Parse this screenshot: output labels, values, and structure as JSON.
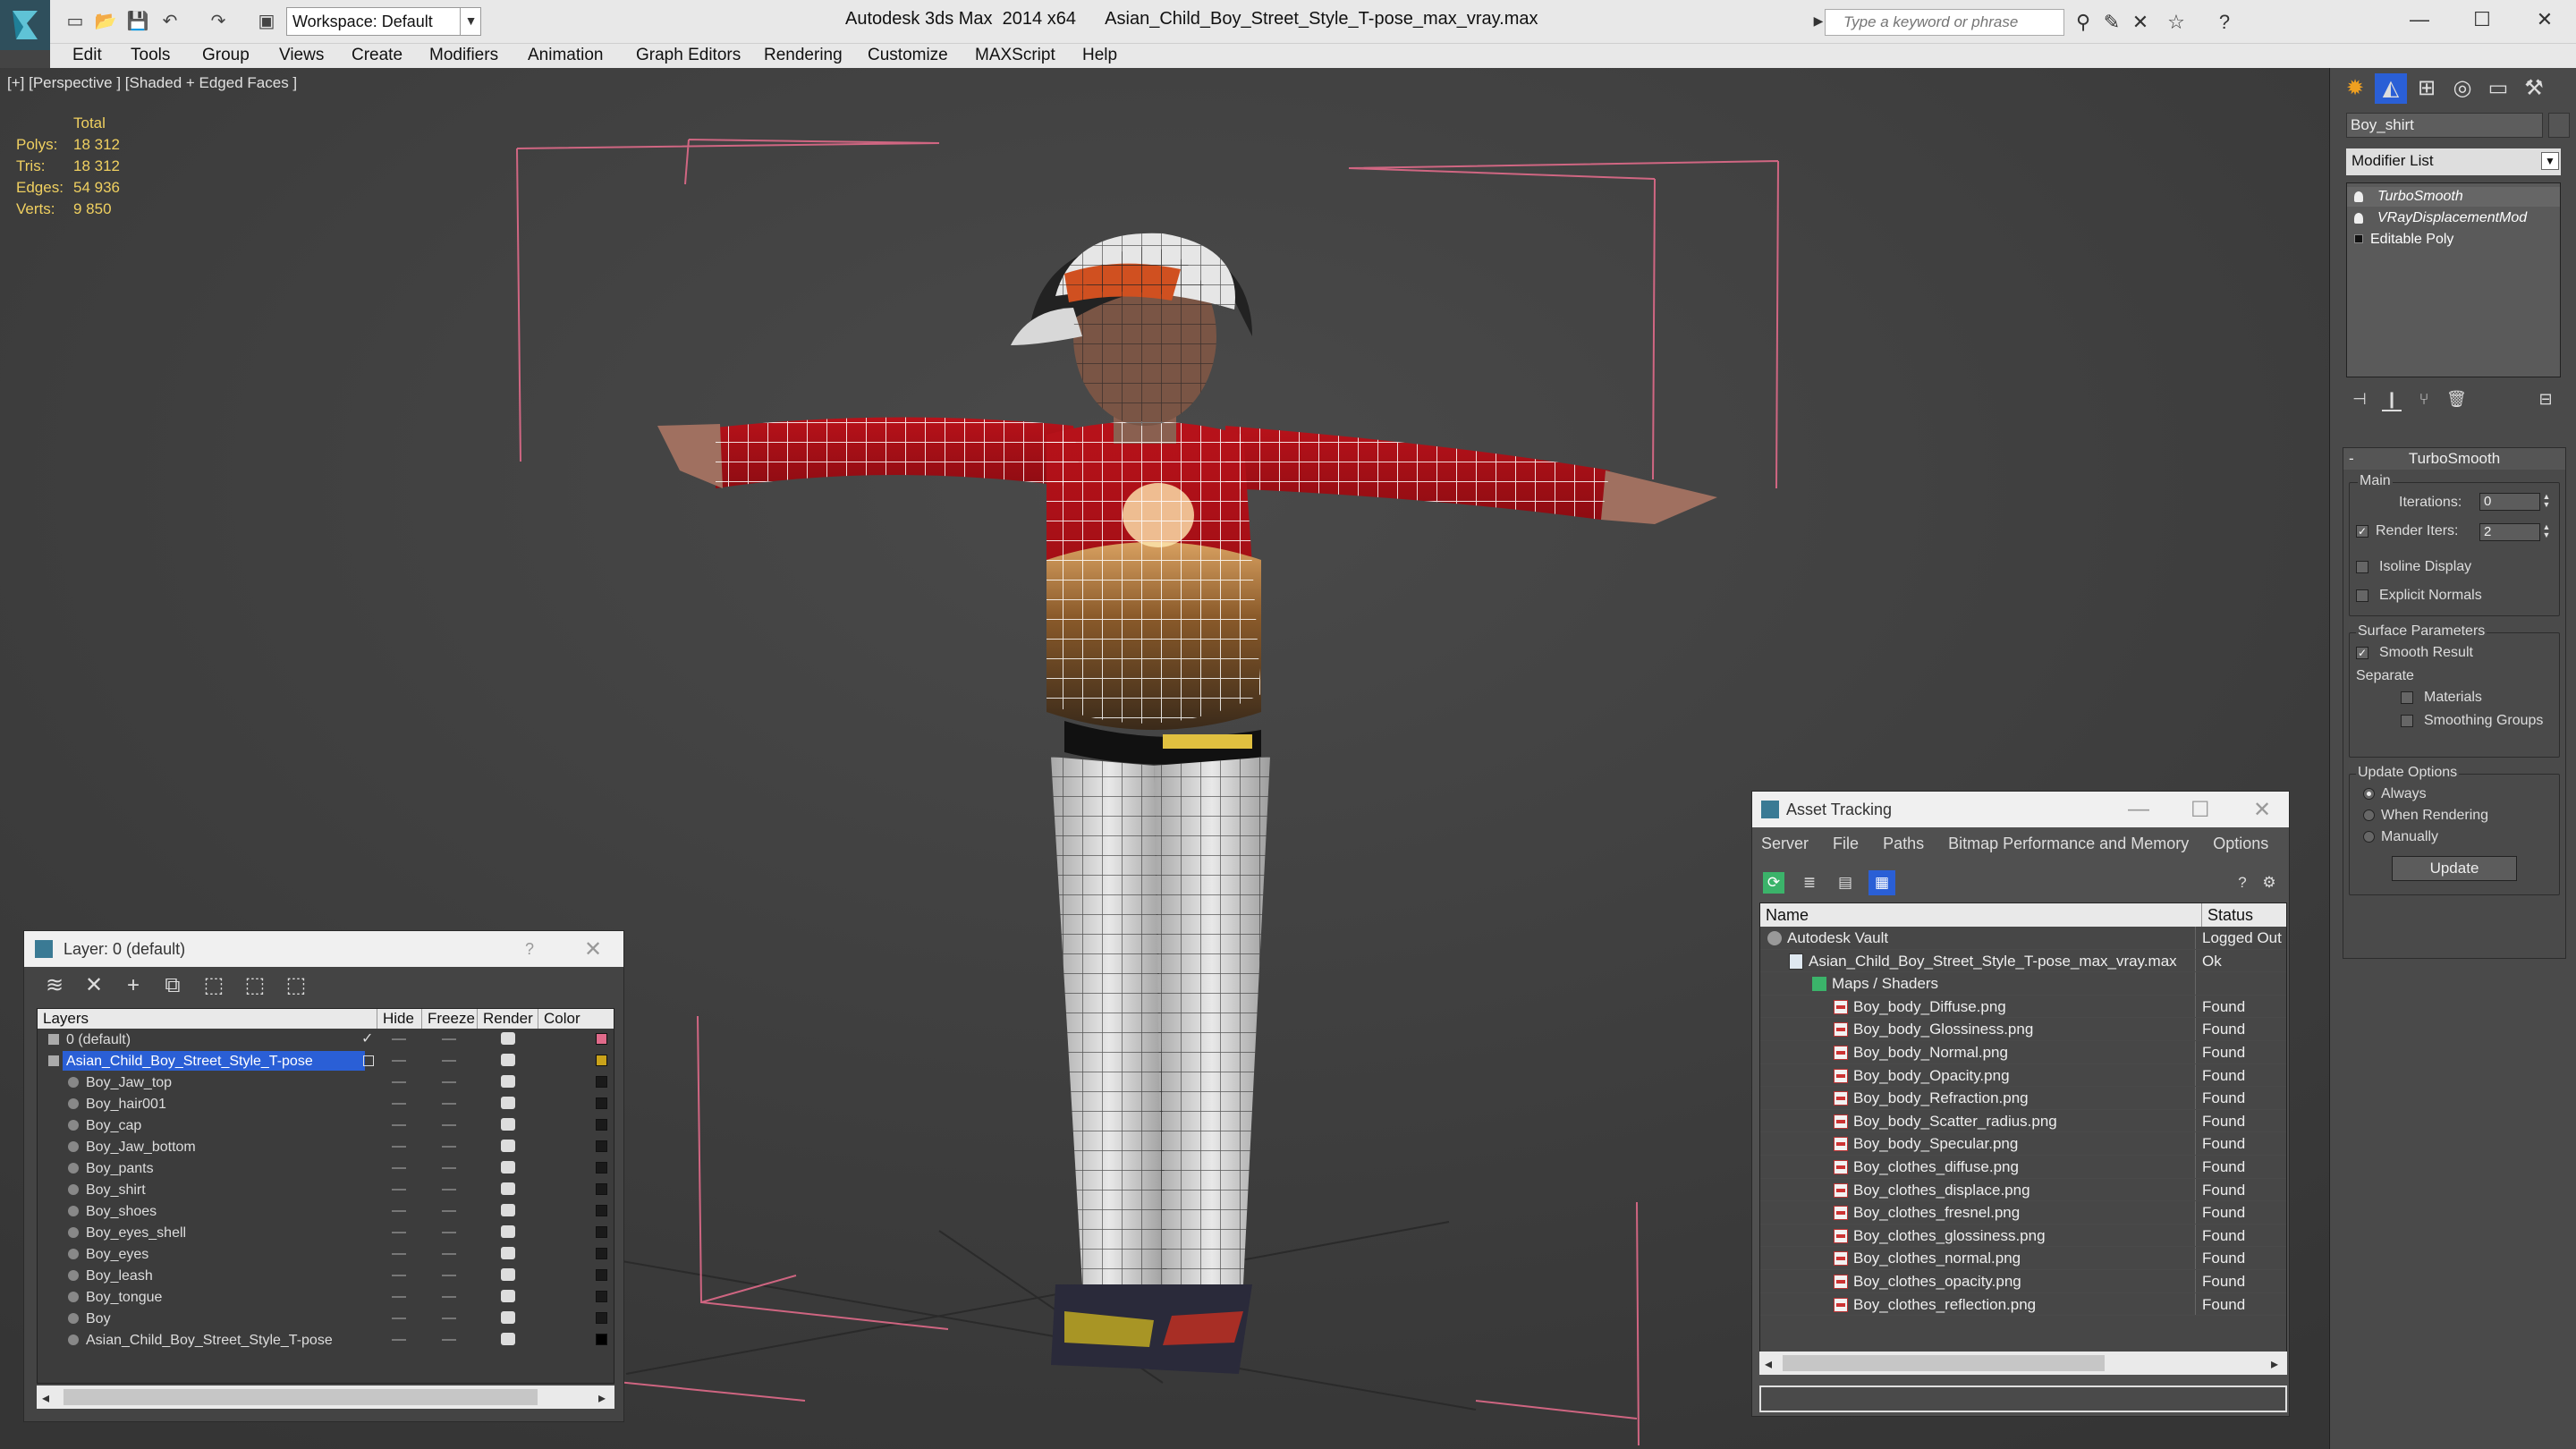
{
  "app": {
    "title": "Autodesk 3ds Max  2014 x64      Asian_Child_Boy_Street_Style_T-pose_max_vray.max",
    "workspace": "Workspace: Default",
    "search_placeholder": "Type a keyword or phrase"
  },
  "menu": [
    "Edit",
    "Tools",
    "Group",
    "Views",
    "Create",
    "Modifiers",
    "Animation",
    "Graph Editors",
    "Rendering",
    "Customize",
    "MAXScript",
    "Help"
  ],
  "viewport": {
    "label": "[+] [Perspective ] [Shaded + Edged Faces ]",
    "stats_header": "Total",
    "stats": [
      {
        "label": "Polys:",
        "value": "18 312"
      },
      {
        "label": "Tris:",
        "value": "18 312"
      },
      {
        "label": "Edges:",
        "value": "54 936"
      },
      {
        "label": "Verts:",
        "value": "9 850"
      }
    ]
  },
  "layer_window": {
    "title": "Layer: 0 (default)",
    "help": "?",
    "columns": [
      "Layers",
      "Hide",
      "Freeze",
      "Render",
      "Color"
    ],
    "rows": [
      {
        "name": "0 (default)",
        "color": "#e06a8a"
      },
      {
        "name": "Asian_Child_Boy_Street_Style_T-pose",
        "color": "#c9a21a",
        "selected": true
      },
      {
        "name": "Boy_Jaw_top",
        "color": "#1a1a1a"
      },
      {
        "name": "Boy_hair001",
        "color": "#1a1a1a"
      },
      {
        "name": "Boy_cap",
        "color": "#1a1a1a"
      },
      {
        "name": "Boy_Jaw_bottom",
        "color": "#1a1a1a"
      },
      {
        "name": "Boy_pants",
        "color": "#1a1a1a"
      },
      {
        "name": "Boy_shirt",
        "color": "#1a1a1a"
      },
      {
        "name": "Boy_shoes",
        "color": "#1a1a1a"
      },
      {
        "name": "Boy_eyes_shell",
        "color": "#1a1a1a"
      },
      {
        "name": "Boy_eyes",
        "color": "#1a1a1a"
      },
      {
        "name": "Boy_leash",
        "color": "#1a1a1a"
      },
      {
        "name": "Boy_tongue",
        "color": "#1a1a1a"
      },
      {
        "name": "Boy",
        "color": "#1a1a1a"
      },
      {
        "name": "Asian_Child_Boy_Street_Style_T-pose",
        "color": "#000000"
      }
    ]
  },
  "asset_window": {
    "title": "Asset Tracking",
    "menu": [
      "Server",
      "File",
      "Paths",
      "Bitmap Performance and Memory",
      "Options"
    ],
    "columns": [
      "Name",
      "Status"
    ],
    "rows": [
      {
        "name": "Autodesk Vault",
        "status": "Logged Out",
        "level": 0
      },
      {
        "name": "Asian_Child_Boy_Street_Style_T-pose_max_vray.max",
        "status": "Ok",
        "level": 1
      },
      {
        "name": "Maps / Shaders",
        "status": "",
        "level": 2
      },
      {
        "name": "Boy_body_Diffuse.png",
        "status": "Found",
        "level": 3
      },
      {
        "name": "Boy_body_Glossiness.png",
        "status": "Found",
        "level": 3
      },
      {
        "name": "Boy_body_Normal.png",
        "status": "Found",
        "level": 3
      },
      {
        "name": "Boy_body_Opacity.png",
        "status": "Found",
        "level": 3
      },
      {
        "name": "Boy_body_Refraction.png",
        "status": "Found",
        "level": 3
      },
      {
        "name": "Boy_body_Scatter_radius.png",
        "status": "Found",
        "level": 3
      },
      {
        "name": "Boy_body_Specular.png",
        "status": "Found",
        "level": 3
      },
      {
        "name": "Boy_clothes_diffuse.png",
        "status": "Found",
        "level": 3
      },
      {
        "name": "Boy_clothes_displace.png",
        "status": "Found",
        "level": 3
      },
      {
        "name": "Boy_clothes_fresnel.png",
        "status": "Found",
        "level": 3
      },
      {
        "name": "Boy_clothes_glossiness.png",
        "status": "Found",
        "level": 3
      },
      {
        "name": "Boy_clothes_normal.png",
        "status": "Found",
        "level": 3
      },
      {
        "name": "Boy_clothes_opacity.png",
        "status": "Found",
        "level": 3
      },
      {
        "name": "Boy_clothes_reflection.png",
        "status": "Found",
        "level": 3
      }
    ]
  },
  "command_panel": {
    "object_name": "Boy_shirt",
    "modifier_list": "Modifier List",
    "stack": [
      {
        "name": "TurboSmooth",
        "italic": true
      },
      {
        "name": "VRayDisplacementMod",
        "italic": true
      },
      {
        "name": "Editable Poly",
        "italic": false
      }
    ],
    "turbosmooth": {
      "title": "TurboSmooth",
      "main": "Main",
      "iterations_label": "Iterations:",
      "iterations": "0",
      "render_iters_label": "Render Iters:",
      "render_iters": "2",
      "isoline": "Isoline Display",
      "explicit_normals": "Explicit Normals",
      "surface_params": "Surface Parameters",
      "smooth_result": "Smooth Result",
      "separate": "Separate",
      "materials": "Materials",
      "smoothing_groups": "Smoothing Groups",
      "update_options": "Update Options",
      "always": "Always",
      "when_rendering": "When Rendering",
      "manually": "Manually",
      "update": "Update"
    }
  }
}
